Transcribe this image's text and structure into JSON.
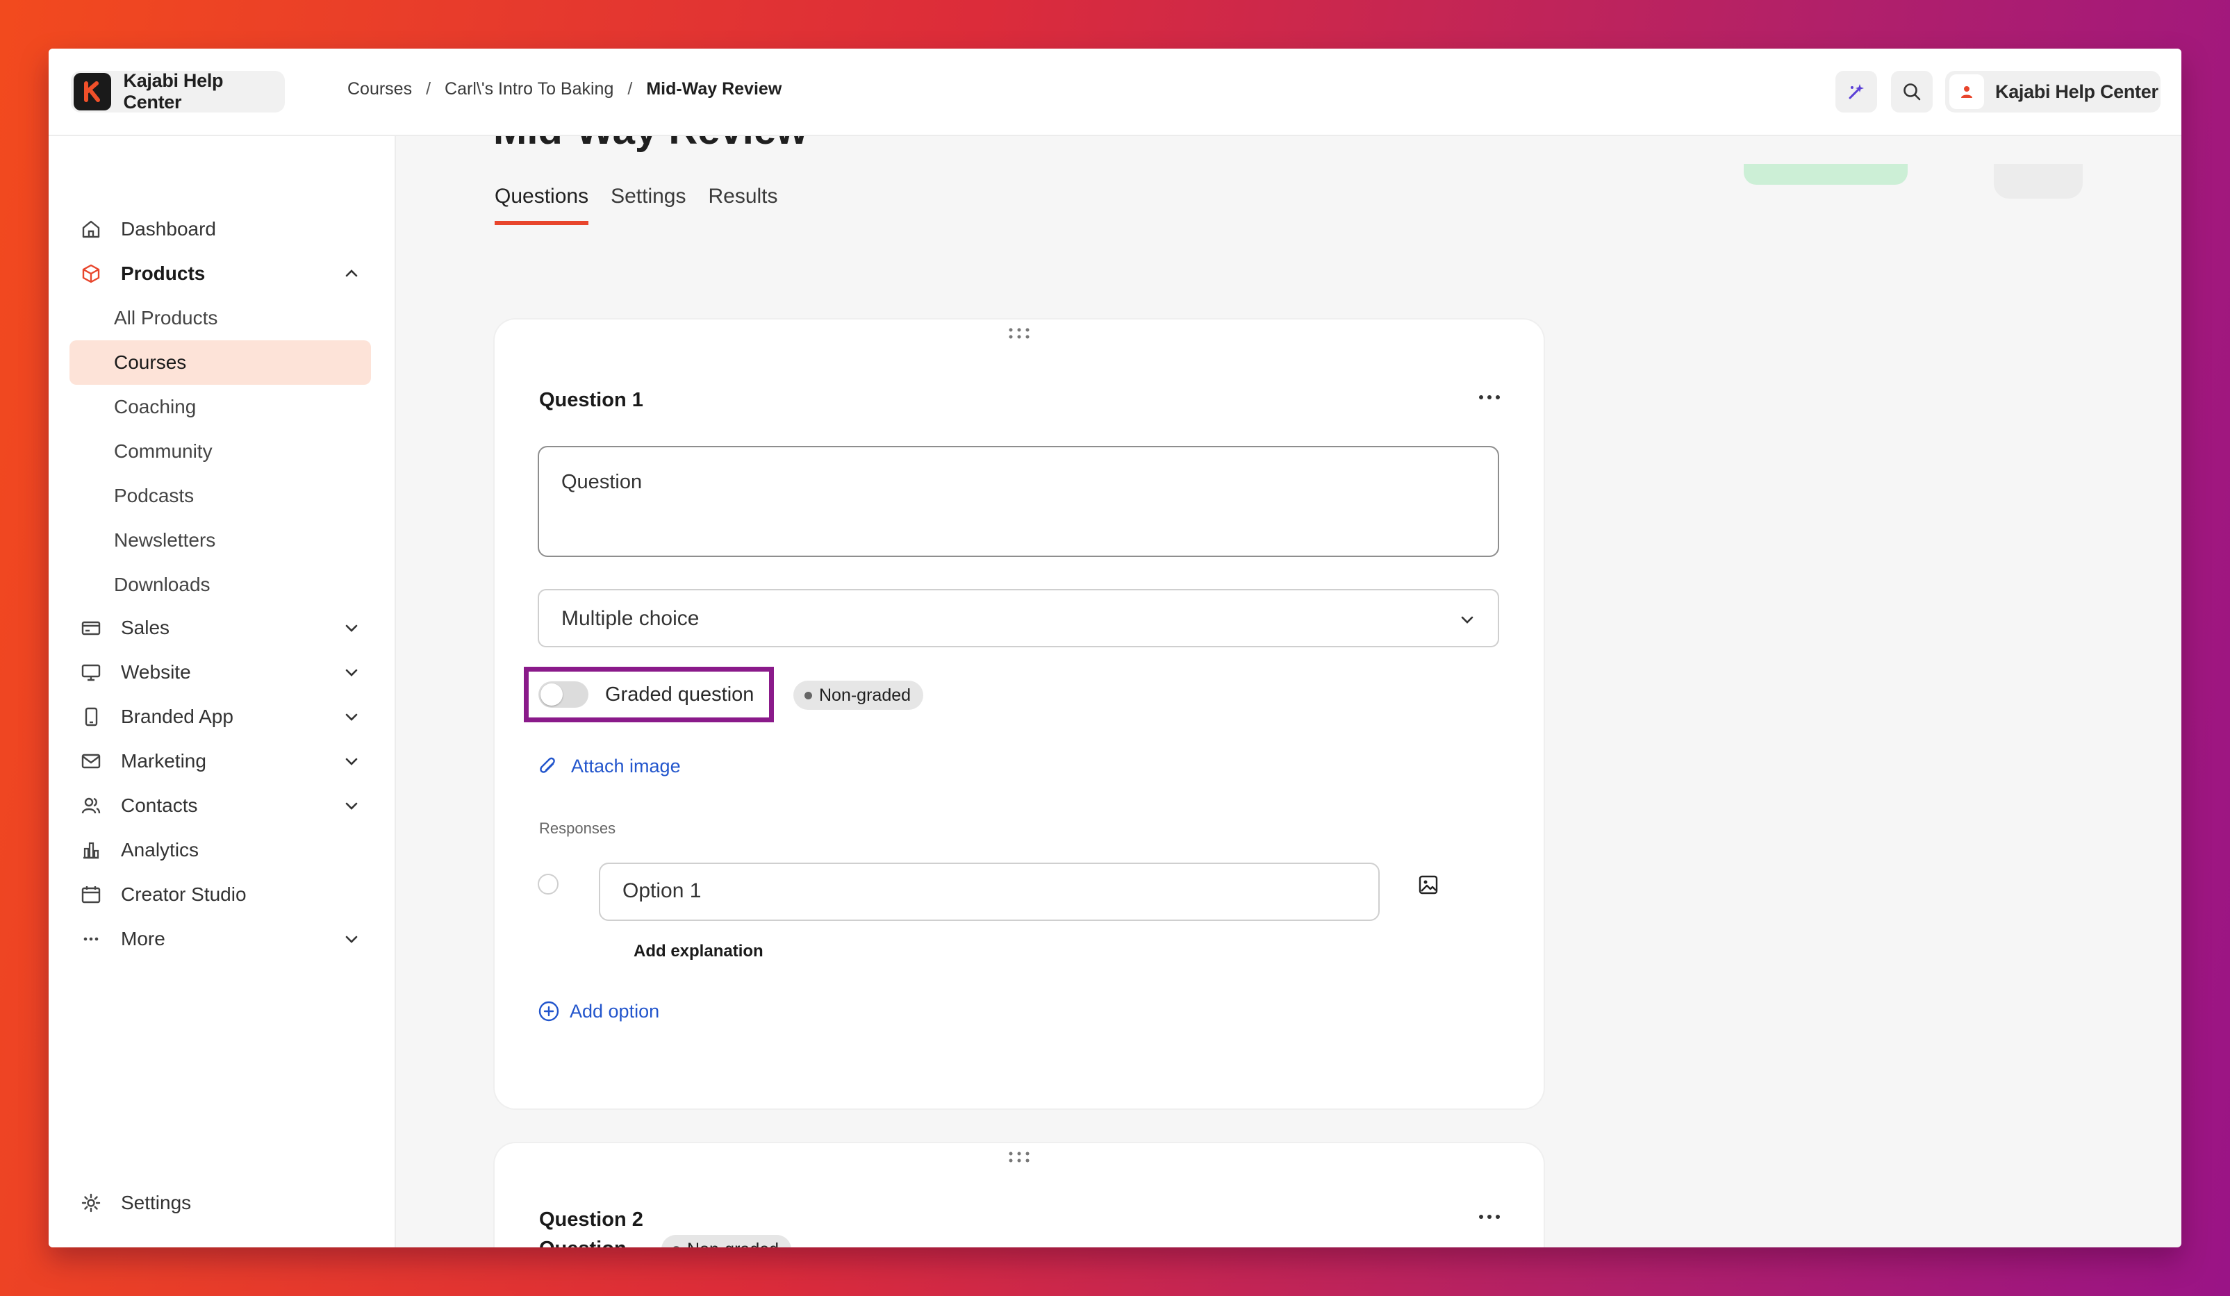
{
  "topbar": {
    "brand": "Kajabi Help Center",
    "breadcrumb": [
      "Courses",
      "Carl\\'s Intro To Baking",
      "Mid-Way Review"
    ],
    "account_name": "Kajabi Help Center"
  },
  "sidebar": {
    "items": [
      {
        "label": "Dashboard",
        "icon": "home-icon"
      },
      {
        "label": "Products",
        "icon": "box-icon"
      },
      {
        "label": "All Products"
      },
      {
        "label": "Courses"
      },
      {
        "label": "Coaching"
      },
      {
        "label": "Community"
      },
      {
        "label": "Podcasts"
      },
      {
        "label": "Newsletters"
      },
      {
        "label": "Downloads"
      },
      {
        "label": "Sales",
        "icon": "credit-card-icon"
      },
      {
        "label": "Website",
        "icon": "monitor-icon"
      },
      {
        "label": "Branded App",
        "icon": "phone-icon"
      },
      {
        "label": "Marketing",
        "icon": "mail-icon"
      },
      {
        "label": "Contacts",
        "icon": "users-icon"
      },
      {
        "label": "Analytics",
        "icon": "bar-chart-icon"
      },
      {
        "label": "Creator Studio",
        "icon": "calendar-icon"
      },
      {
        "label": "More",
        "icon": "ellipsis-icon"
      }
    ],
    "settings": "Settings"
  },
  "main": {
    "title": "Mid-Way Review",
    "tabs": [
      "Questions",
      "Settings",
      "Results"
    ],
    "question1": {
      "title": "Question 1",
      "question_placeholder": "Question",
      "type": "Multiple choice",
      "graded_label": "Graded question",
      "badge": "Non-graded",
      "attach_label": "Attach image",
      "responses_label": "Responses",
      "option1": "Option 1",
      "add_explanation": "Add explanation",
      "add_option": "Add option"
    },
    "question2": {
      "title": "Question 2",
      "subtitle": "Question",
      "badge": "Non-graded"
    }
  },
  "colors": {
    "accent": "#e8452c",
    "link": "#2255cc",
    "active_bg": "#fde3d8",
    "highlight_box": "#8a1a8a"
  }
}
